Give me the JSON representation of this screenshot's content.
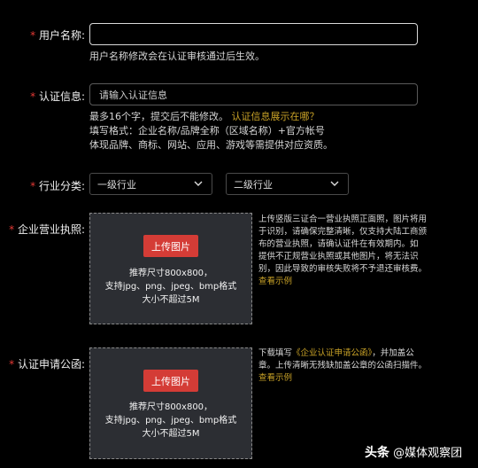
{
  "fields": {
    "username": {
      "star": "*",
      "label": "用户名称:",
      "value": "",
      "hint": "用户名称修改会在认证审核通过后生效。"
    },
    "cert_info": {
      "star": "*",
      "label": "认证信息:",
      "placeholder": "请输入认证信息",
      "hint1": "最多16个字，提交后不能修改。",
      "hint_link": "认证信息展示在哪？",
      "hint2": "填写格式：企业名称/品牌全称（区域名称）+官方帐号",
      "hint3": "体现品牌、商标、网站、应用、游戏等需提供对应资质。"
    },
    "industry": {
      "star": "*",
      "label": "行业分类:",
      "select1": "一级行业",
      "select2": "二级行业"
    },
    "license": {
      "star": "*",
      "label": "企业营业执照:",
      "upload_label": "上传图片",
      "size_line": "推荐尺寸800x800，",
      "format_line": "支持jpg、png、jpeg、bmp格式",
      "max_line": "大小不超过5M",
      "side_lines": [
        "上传竖版三证合一营业执照正面照，图片将用",
        "于识别，请确保完整清晰，仅支持大陆工商颁",
        "布的营业执照，请确认证件在有效期内。如",
        "提供不正规营业执照或其他图片，将无法识",
        "别，因此导致的审核失败将不予退还审核费。"
      ],
      "example_link": "查看示例"
    },
    "letter": {
      "star": "*",
      "label": "认证申请公函:",
      "upload_label": "上传图片",
      "size_line": "推荐尺寸800x800，",
      "format_line": "支持jpg、png、jpeg、bmp格式",
      "max_line": "大小不超过5M",
      "side_prefix": "下载填写",
      "side_link": "《企业认证申请公函》",
      "side_suffix": "，并加盖公",
      "side_line2": "章。上传清晰无残缺加盖公章的公函扫描件。",
      "example_link": "查看示例"
    }
  },
  "watermark": {
    "brand": "头条",
    "handle": "@媒体观察团"
  },
  "colors": {
    "accent_red": "#d43c36",
    "link_gold": "#c9a227",
    "background": "#000000"
  }
}
